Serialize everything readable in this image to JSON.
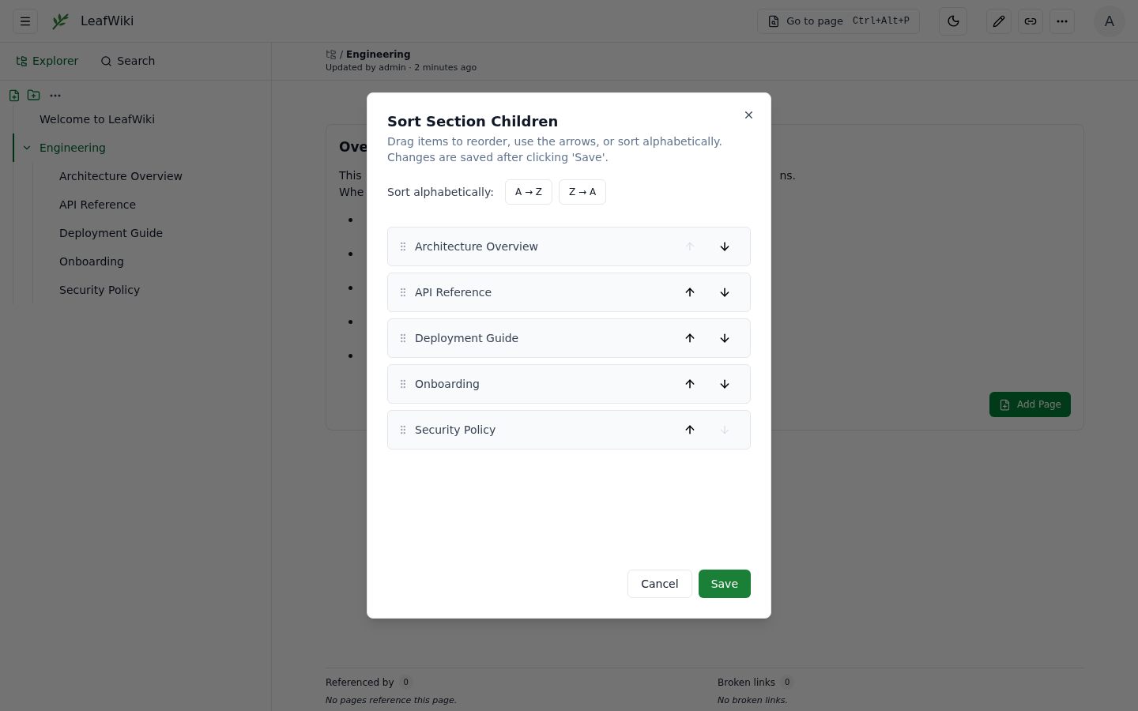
{
  "header": {
    "app_name": "LeafWiki",
    "goto": {
      "label": "Go to page",
      "shortcut": "Ctrl+Alt+P"
    },
    "avatar": "A"
  },
  "sidebar": {
    "tabs": [
      {
        "label": "Explorer",
        "selected": true
      },
      {
        "label": "Search",
        "selected": false
      }
    ],
    "tree": [
      {
        "label": "Welcome to LeafWiki",
        "selected": false
      },
      {
        "label": "Engineering",
        "selected": true,
        "expanded": true,
        "children": [
          {
            "label": "Architecture Overview",
            "selected": false
          },
          {
            "label": "API Reference",
            "selected": false
          },
          {
            "label": "Deployment Guide",
            "selected": false
          },
          {
            "label": "Onboarding",
            "selected": false
          },
          {
            "label": "Security Policy",
            "selected": false
          }
        ]
      }
    ]
  },
  "page": {
    "breadcrumb_separator": "/",
    "breadcrumb": "Engineering",
    "updated": "Updated by admin · 2 minutes ago",
    "heading": "Ove",
    "line_1_start": "This",
    "line_1_end": "ns.",
    "line_2_start": "Whe",
    "bullets": [
      {
        "kind": "bullet"
      },
      {
        "kind": "bullet"
      },
      {
        "kind": "bullet"
      },
      {
        "kind": "bullet"
      },
      {
        "kind": "bullet"
      }
    ],
    "add_page": "Add Page",
    "footer": [
      {
        "label": "Referenced by",
        "count": "0",
        "note": "No pages reference this page."
      },
      {
        "label": "Broken links",
        "count": "0",
        "note": "No broken links."
      }
    ]
  },
  "dialog": {
    "title": "Sort Section Children",
    "description": "Drag items to reorder, use the arrows, or sort alphabetically. Changes are saved after clicking 'Save'.",
    "sort_label": "Sort alphabetically:",
    "sort_buttons": [
      "A → Z",
      "Z → A"
    ],
    "items": [
      {
        "label": "Architecture Overview",
        "up_disabled": true,
        "down_disabled": false
      },
      {
        "label": "API Reference",
        "up_disabled": false,
        "down_disabled": false
      },
      {
        "label": "Deployment Guide",
        "up_disabled": false,
        "down_disabled": false
      },
      {
        "label": "Onboarding",
        "up_disabled": false,
        "down_disabled": false
      },
      {
        "label": "Security Policy",
        "up_disabled": false,
        "down_disabled": true
      }
    ],
    "cancel": "Cancel",
    "save": "Save"
  }
}
